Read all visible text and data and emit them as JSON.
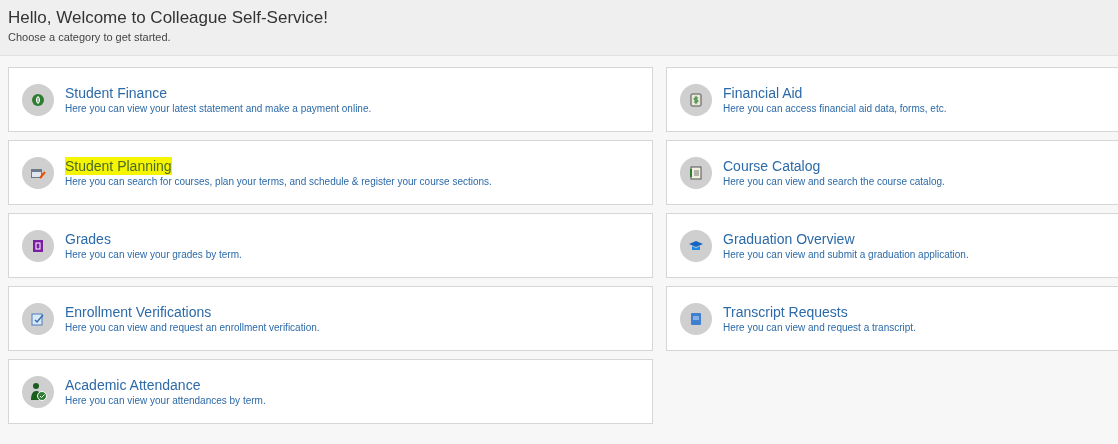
{
  "header": {
    "title": "Hello, Welcome to Colleague Self-Service!",
    "subtitle": "Choose a category to get started."
  },
  "categories": [
    {
      "kind": "finance",
      "title": "Student Finance",
      "description": "Here you can view your latest statement and make a payment online.",
      "highlighted": false
    },
    {
      "kind": "aid",
      "title": "Financial Aid",
      "description": "Here you can access financial aid data, forms, etc.",
      "highlighted": false
    },
    {
      "kind": "planning",
      "title": "Student Planning",
      "description": "Here you can search for courses, plan your terms, and schedule & register your course sections.",
      "highlighted": true
    },
    {
      "kind": "catalog",
      "title": "Course Catalog",
      "description": "Here you can view and search the course catalog.",
      "highlighted": false
    },
    {
      "kind": "grades",
      "title": "Grades",
      "description": "Here you can view your grades by term.",
      "highlighted": false
    },
    {
      "kind": "graduation",
      "title": "Graduation Overview",
      "description": "Here you can view and submit a graduation application.",
      "highlighted": false
    },
    {
      "kind": "enrollment",
      "title": "Enrollment Verifications",
      "description": "Here you can view and request an enrollment verification.",
      "highlighted": false
    },
    {
      "kind": "transcript",
      "title": "Transcript Requests",
      "description": "Here you can view and request a transcript.",
      "highlighted": false
    },
    {
      "kind": "attendance",
      "title": "Academic Attendance",
      "description": "Here you can view your attendances by term.",
      "highlighted": false
    }
  ]
}
